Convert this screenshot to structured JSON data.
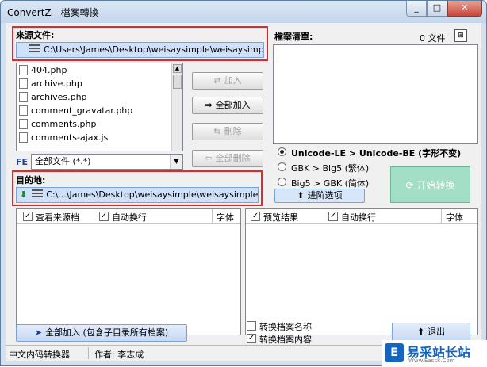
{
  "window": {
    "title": "ConvertZ - 檔案轉換",
    "minimize": "_",
    "maximize": "□",
    "close": "✕"
  },
  "source": {
    "label": "來源文件:",
    "path": "C:\\Users\\James\\Desktop\\weisaysimple\\weisaysimple",
    "files": [
      "404.php",
      "archive.php",
      "archives.php",
      "comment_gravatar.php",
      "comments.php",
      "comments-ajax.js"
    ],
    "filter_badge": "FE",
    "filter": "全部文件 (*.*)"
  },
  "file_list_label": "檔案清單:",
  "file_count": "0 文件",
  "actions": {
    "add": "加入",
    "add_all": "全部加入",
    "delete": "刪除",
    "delete_all": "全部刪除"
  },
  "destination": {
    "label": "目的地:",
    "path": "C:\\...\\James\\Desktop\\weisaysimple\\weisaysimple-new"
  },
  "conversion": {
    "options": [
      {
        "label": "Unicode-LE > Unicode-BE (字形不变)",
        "selected": true
      },
      {
        "label": "GBK > Big5  (繁体)",
        "selected": false
      },
      {
        "label": "Big5 > GBK  (简体)",
        "selected": false
      }
    ],
    "advanced": "进阶选项",
    "start": "开始转换"
  },
  "left_panel": {
    "view_source": "查看来源档",
    "auto_wrap": "自动换行",
    "font": "字体"
  },
  "right_panel": {
    "preview": "预览结果",
    "auto_wrap": "自动换行",
    "font": "字体"
  },
  "bottom": {
    "add_all_sub": "全部加入 (包含子目录所有档案)",
    "convert_name": "转换档案名称",
    "convert_content": "转换档案内容",
    "exit": "退出"
  },
  "status": {
    "app": "中文内码转换器",
    "author": "作者: 李志成"
  },
  "watermark": {
    "logo": "E",
    "name": "易采站长站",
    "sub": "Www.Easck.Com"
  },
  "colors": {
    "highlight_box": "#e0282e",
    "path_bar": "#cfe0fb",
    "start_button": "#a3dfc6"
  }
}
